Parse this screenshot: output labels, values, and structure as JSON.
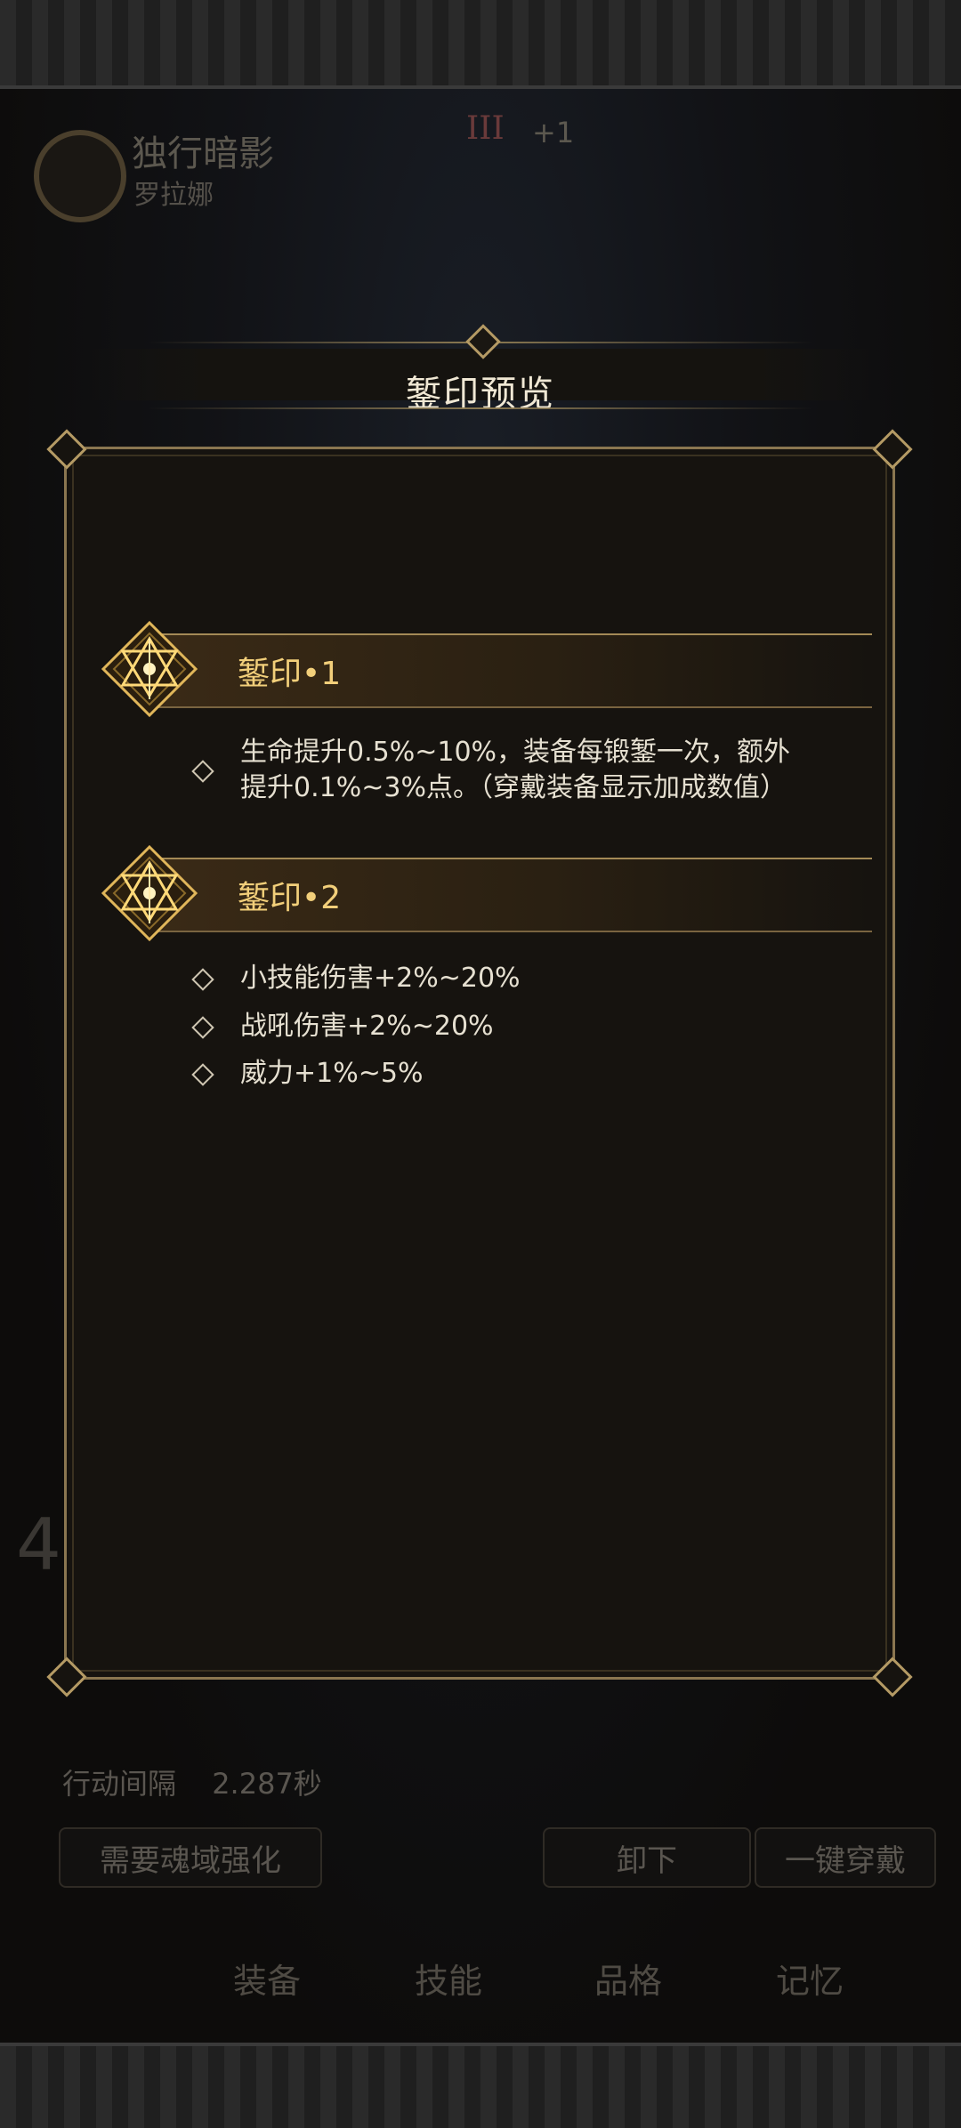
{
  "background": {
    "character_title": "独行暗影",
    "character_name": "罗拉娜",
    "roman_level": "III",
    "plus_level": "+1",
    "stat_label": "行动间隔",
    "stat_value": "2.287秒",
    "big_digit": "4",
    "buttons": [
      "需要魂域强化",
      "卸下",
      "一键穿戴"
    ],
    "tabs": [
      "装备",
      "技能",
      "品格",
      "记忆"
    ]
  },
  "modal": {
    "title": "錾印预览",
    "sections": [
      {
        "title": "錾印•1",
        "lines": [
          "生命提升0.5%~10%，装备每锻錾一次，额外",
          "提升0.1%~3%点。（穿戴装备显示加成数值）"
        ]
      },
      {
        "title": "錾印•2",
        "lines": [
          "小技能伤害+2%~20%",
          "战吼伤害+2%~20%",
          "威力+1%~5%"
        ]
      }
    ]
  },
  "colors": {
    "accent_gold": "#f2cf7a",
    "frame_gold": "#8a7650",
    "panel_bg": "#16130f"
  }
}
